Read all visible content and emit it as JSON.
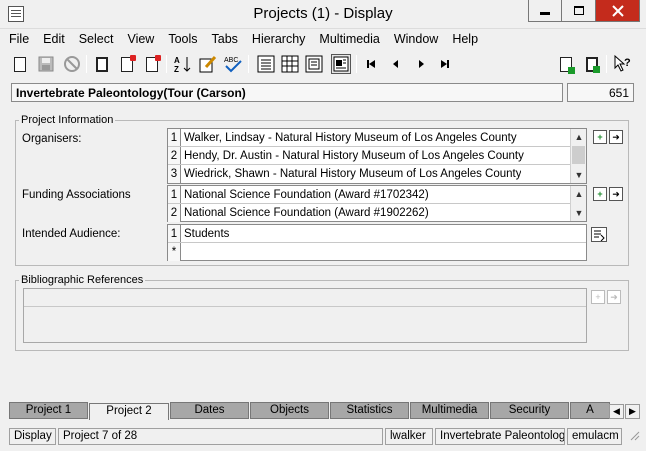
{
  "window": {
    "title": "Projects (1) - Display"
  },
  "menu": [
    "File",
    "Edit",
    "Select",
    "View",
    "Tools",
    "Tabs",
    "Hierarchy",
    "Multimedia",
    "Window",
    "Help"
  ],
  "header": {
    "title_value": "Invertebrate Paleontology(Tour (Carson)",
    "record_number": "651"
  },
  "project_information": {
    "legend": "Project Information",
    "organisers": {
      "label": "Organisers:",
      "rows": [
        {
          "n": "1",
          "text": "Walker, Lindsay - Natural History Museum of Los Angeles County"
        },
        {
          "n": "2",
          "text": "Hendy, Dr. Austin - Natural History Museum of Los Angeles County"
        },
        {
          "n": "3",
          "text": "Wiedrick, Shawn - Natural History Museum of Los Angeles County"
        }
      ]
    },
    "funding": {
      "label": "Funding Associations",
      "rows": [
        {
          "n": "1",
          "text": "National Science Foundation (Award #1702342)"
        },
        {
          "n": "2",
          "text": "National Science Foundation (Award #1902262)"
        }
      ]
    },
    "audience": {
      "label": "Intended Audience:",
      "rows": [
        {
          "n": "1",
          "text": "Students"
        },
        {
          "n": "*",
          "text": ""
        }
      ]
    }
  },
  "bibliographic": {
    "legend": "Bibliographic References"
  },
  "tabs": [
    "Project 1",
    "Project 2",
    "Dates",
    "Objects",
    "Statistics",
    "Multimedia",
    "Security",
    "A"
  ],
  "active_tab": "Project 2",
  "status": {
    "mode": "Display",
    "record": "Project 7 of 28",
    "user": "lwalker",
    "context": "Invertebrate Paleontology",
    "host": "emulacm"
  },
  "icons": {
    "abc_check": "ABC",
    "az_sort": "AZ"
  }
}
